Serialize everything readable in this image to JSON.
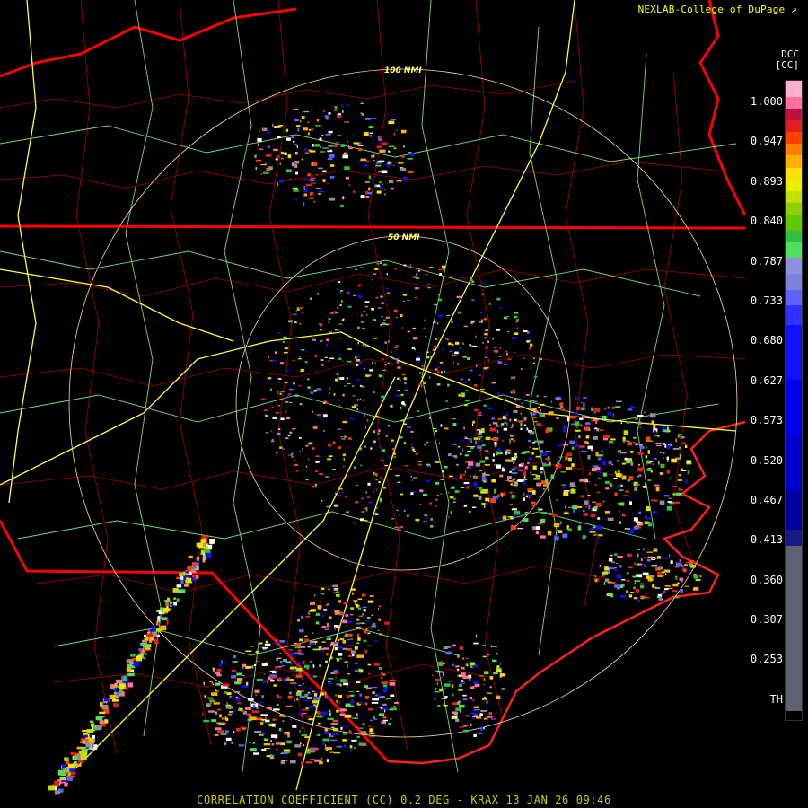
{
  "credit": "NEXLAB-College of DuPage",
  "credit_icon": "external-link-icon",
  "legend": {
    "product": "DCC",
    "unit": "[CC]",
    "labels": [
      "1.000",
      "0.947",
      "0.893",
      "0.840",
      "0.787",
      "0.733",
      "0.680",
      "0.627",
      "0.573",
      "0.520",
      "0.467",
      "0.413",
      "0.360",
      "0.307",
      "0.253",
      "TH"
    ],
    "swatches": [
      {
        "value": 1.0,
        "color": "#ffb0d0"
      },
      {
        "value": 0.98,
        "color": "#ff70a0"
      },
      {
        "value": 0.965,
        "color": "#c01040"
      },
      {
        "value": 0.95,
        "color": "#e02020"
      },
      {
        "value": 0.935,
        "color": "#ff4000"
      },
      {
        "value": 0.92,
        "color": "#ff7f00"
      },
      {
        "value": 0.905,
        "color": "#ffb000"
      },
      {
        "value": 0.89,
        "color": "#ffe000"
      },
      {
        "value": 0.875,
        "color": "#e8f000"
      },
      {
        "value": 0.86,
        "color": "#c0e000"
      },
      {
        "value": 0.845,
        "color": "#90d000"
      },
      {
        "value": 0.83,
        "color": "#60c800"
      },
      {
        "value": 0.81,
        "color": "#30c040"
      },
      {
        "value": 0.795,
        "color": "#50e060"
      },
      {
        "value": 0.775,
        "color": "#9090e0"
      },
      {
        "value": 0.755,
        "color": "#8080d8"
      },
      {
        "value": 0.735,
        "color": "#6060ff"
      },
      {
        "value": 0.715,
        "color": "#3030ff"
      },
      {
        "value": 0.69,
        "color": "#1010ff"
      },
      {
        "value": 0.62,
        "color": "#0000f0"
      },
      {
        "value": 0.55,
        "color": "#0000d0"
      },
      {
        "value": 0.48,
        "color": "#0000a0"
      },
      {
        "value": 0.43,
        "color": "#1a1a80"
      },
      {
        "value": 0.41,
        "color": "#606070"
      },
      {
        "value": 0.2,
        "color": "#909098"
      }
    ],
    "threshold_color": "#000000"
  },
  "range_rings": [
    "100 NMI",
    "50 NMI"
  ],
  "footer": "CORRELATION COEFFICIENT (CC) 0.2 DEG - KRAX 13 JAN 26 09:46",
  "colors": {
    "background": "#000000",
    "state_border": "#ff0000",
    "county_border": "#a00000",
    "highway": "#90ff90",
    "interstate": "#ffff40",
    "range_ring": "#ffdd99"
  }
}
